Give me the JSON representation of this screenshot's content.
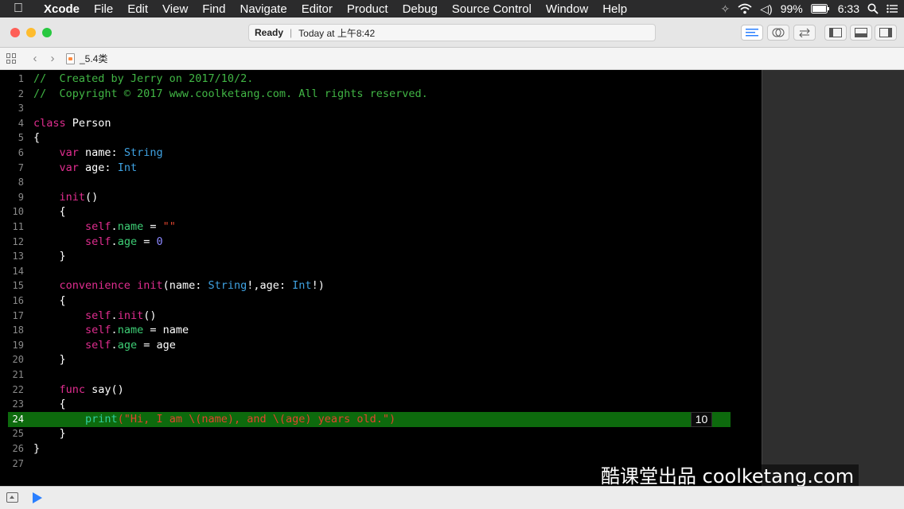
{
  "menubar": {
    "app": "Xcode",
    "items": [
      "File",
      "Edit",
      "View",
      "Find",
      "Navigate",
      "Editor",
      "Product",
      "Debug",
      "Source Control",
      "Window",
      "Help"
    ],
    "battery": "99%",
    "time": "6:33"
  },
  "toolbar": {
    "status": "Ready",
    "timestamp": "Today at 上午8:42"
  },
  "jumpbar": {
    "file": "_5.4类"
  },
  "editor": {
    "highlighted_line": 24,
    "result_badge": "10",
    "lines": [
      {
        "n": "1",
        "t": [
          [
            "comment",
            "//  Created by Jerry on 2017/10/2."
          ]
        ]
      },
      {
        "n": "2",
        "t": [
          [
            "comment",
            "//  Copyright © 2017 www.coolketang.com. All rights reserved."
          ]
        ]
      },
      {
        "n": "3",
        "t": []
      },
      {
        "n": "4",
        "t": [
          [
            "keyword",
            "class"
          ],
          [
            "plain",
            " Person"
          ]
        ]
      },
      {
        "n": "5",
        "t": [
          [
            "plain",
            "{"
          ]
        ]
      },
      {
        "n": "6",
        "t": [
          [
            "plain",
            "    "
          ],
          [
            "keyword",
            "var"
          ],
          [
            "plain",
            " name: "
          ],
          [
            "type",
            "String"
          ]
        ]
      },
      {
        "n": "7",
        "t": [
          [
            "plain",
            "    "
          ],
          [
            "keyword",
            "var"
          ],
          [
            "plain",
            " age: "
          ],
          [
            "type",
            "Int"
          ]
        ]
      },
      {
        "n": "8",
        "t": []
      },
      {
        "n": "9",
        "t": [
          [
            "plain",
            "    "
          ],
          [
            "keyword",
            "init"
          ],
          [
            "plain",
            "()"
          ]
        ]
      },
      {
        "n": "10",
        "t": [
          [
            "plain",
            "    {"
          ]
        ]
      },
      {
        "n": "11",
        "t": [
          [
            "plain",
            "        "
          ],
          [
            "keyword",
            "self"
          ],
          [
            "plain",
            "."
          ],
          [
            "prop",
            "name"
          ],
          [
            "plain",
            " = "
          ],
          [
            "string",
            "\"\""
          ]
        ]
      },
      {
        "n": "12",
        "t": [
          [
            "plain",
            "        "
          ],
          [
            "keyword",
            "self"
          ],
          [
            "plain",
            "."
          ],
          [
            "prop",
            "age"
          ],
          [
            "plain",
            " = "
          ],
          [
            "number",
            "0"
          ]
        ]
      },
      {
        "n": "13",
        "t": [
          [
            "plain",
            "    }"
          ]
        ]
      },
      {
        "n": "14",
        "t": []
      },
      {
        "n": "15",
        "t": [
          [
            "plain",
            "    "
          ],
          [
            "keyword",
            "convenience"
          ],
          [
            "plain",
            " "
          ],
          [
            "keyword",
            "init"
          ],
          [
            "plain",
            "(name: "
          ],
          [
            "type",
            "String"
          ],
          [
            "plain",
            "!,age: "
          ],
          [
            "type",
            "Int"
          ],
          [
            "plain",
            "!)"
          ]
        ]
      },
      {
        "n": "16",
        "t": [
          [
            "plain",
            "    {"
          ]
        ]
      },
      {
        "n": "17",
        "t": [
          [
            "plain",
            "        "
          ],
          [
            "keyword",
            "self"
          ],
          [
            "plain",
            "."
          ],
          [
            "keyword",
            "init"
          ],
          [
            "plain",
            "()"
          ]
        ]
      },
      {
        "n": "18",
        "t": [
          [
            "plain",
            "        "
          ],
          [
            "keyword",
            "self"
          ],
          [
            "plain",
            "."
          ],
          [
            "prop",
            "name"
          ],
          [
            "plain",
            " = name"
          ]
        ]
      },
      {
        "n": "19",
        "t": [
          [
            "plain",
            "        "
          ],
          [
            "keyword",
            "self"
          ],
          [
            "plain",
            "."
          ],
          [
            "prop",
            "age"
          ],
          [
            "plain",
            " = age"
          ]
        ]
      },
      {
        "n": "20",
        "t": [
          [
            "plain",
            "    }"
          ]
        ]
      },
      {
        "n": "21",
        "t": []
      },
      {
        "n": "22",
        "t": [
          [
            "plain",
            "    "
          ],
          [
            "keyword",
            "func"
          ],
          [
            "plain",
            " say()"
          ]
        ]
      },
      {
        "n": "23",
        "t": [
          [
            "plain",
            "    {"
          ]
        ]
      },
      {
        "n": "24",
        "t": [
          [
            "plain",
            "        "
          ],
          [
            "func",
            "print"
          ],
          [
            "string",
            "(\"Hi, I am \\(name), and \\(age) years old.\")"
          ]
        ]
      },
      {
        "n": "25",
        "t": [
          [
            "plain",
            "    }"
          ]
        ]
      },
      {
        "n": "26",
        "t": [
          [
            "plain",
            "}"
          ]
        ]
      },
      {
        "n": "27",
        "t": []
      }
    ]
  },
  "watermark": "酷课堂出品 coolketang.com",
  "colors": {
    "comment": "#41b645",
    "keyword": "#e02d8f",
    "type": "#3fa2e2",
    "highlight": "#0d6a0d",
    "run_button": "#2a7fff"
  }
}
